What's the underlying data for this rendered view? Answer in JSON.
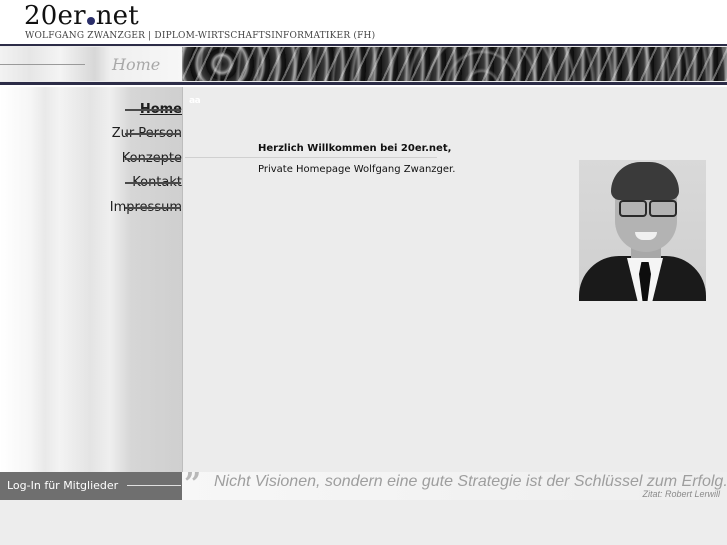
{
  "header": {
    "logo_left": "20er",
    "logo_right": "net",
    "subtitle": "WOLFGANG ZWANZGER | DIPLOM-WIRTSCHAFTSINFORMATIKER (FH)"
  },
  "banner": {
    "title": "Home"
  },
  "nav": {
    "items": [
      {
        "label": "Home",
        "active": true
      },
      {
        "label": "Zur Person",
        "active": false
      },
      {
        "label": "Konzepte",
        "active": false
      },
      {
        "label": "Kontakt",
        "active": false
      },
      {
        "label": "Impressum",
        "active": false
      }
    ]
  },
  "content": {
    "aa_mark": "aa",
    "welcome_title": "Herzlich Willkommen bei 20er.net,",
    "welcome_text": "Private Homepage Wolfgang Zwanzger.",
    "photo_icon": "portrait-photo"
  },
  "footer": {
    "login_label": "Log-In für Mitglieder",
    "quote_mark": "”",
    "quote_text": "Nicht Visionen, sondern eine gute Strategie ist der Schlüssel zum Erfolg.",
    "quote_author": "Zitat: Robert Lerwill"
  },
  "colors": {
    "accent": "#2c2c47",
    "logo_dot": "#2b2f6a",
    "login_bar": "#6f6f6f"
  }
}
